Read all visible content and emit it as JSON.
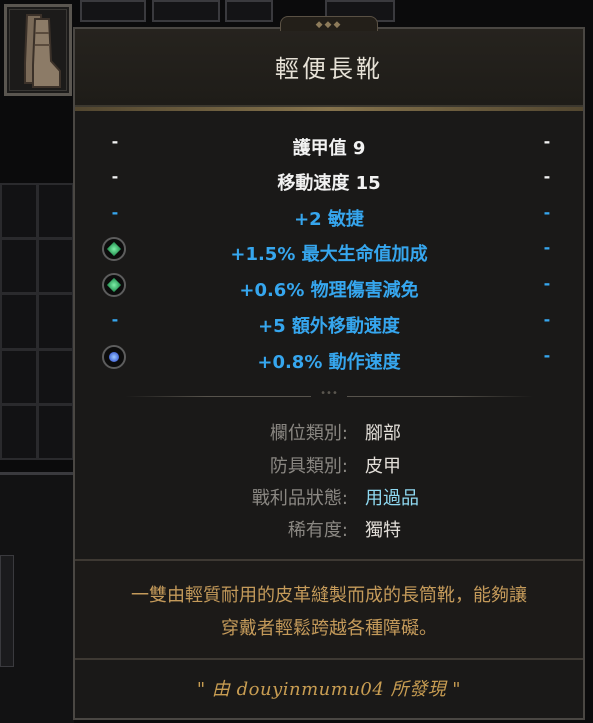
{
  "item": {
    "name": "輕便長靴",
    "stats": [
      {
        "text": "護甲值 9",
        "style": "white",
        "gem": "none"
      },
      {
        "text": "移動速度 15",
        "style": "white",
        "gem": "none"
      },
      {
        "text": "+2 敏捷",
        "style": "blue",
        "gem": "none"
      },
      {
        "text": "+1.5% 最大生命值加成",
        "style": "blue",
        "gem": "green"
      },
      {
        "text": "+0.6% 物理傷害減免",
        "style": "blue",
        "gem": "green"
      },
      {
        "text": "+5 額外移動速度",
        "style": "blue",
        "gem": "none"
      },
      {
        "text": "+0.8% 動作速度",
        "style": "blue",
        "gem": "blue"
      }
    ],
    "dash": "-",
    "divider_dots": "•••",
    "info": [
      {
        "label": "欄位類別:",
        "value": "腳部"
      },
      {
        "label": "防具類別:",
        "value": "皮甲"
      },
      {
        "label": "戰利品狀態:",
        "value": "用過品"
      },
      {
        "label": "稀有度:",
        "value": "獨特"
      }
    ],
    "description": [
      "一雙由輕質耐用的皮革縫製而成的長筒靴，能夠讓",
      "穿戴者輕鬆跨越各種障礙。"
    ],
    "finder": "\" 由 douyinmumu04 所發現 \""
  },
  "colors": {
    "stat_white": "#f2f2f2",
    "stat_blue": "#36a6ee",
    "loot_state": "#8fd9f1",
    "description": "#c49a5a",
    "finder": "#c89d52"
  }
}
